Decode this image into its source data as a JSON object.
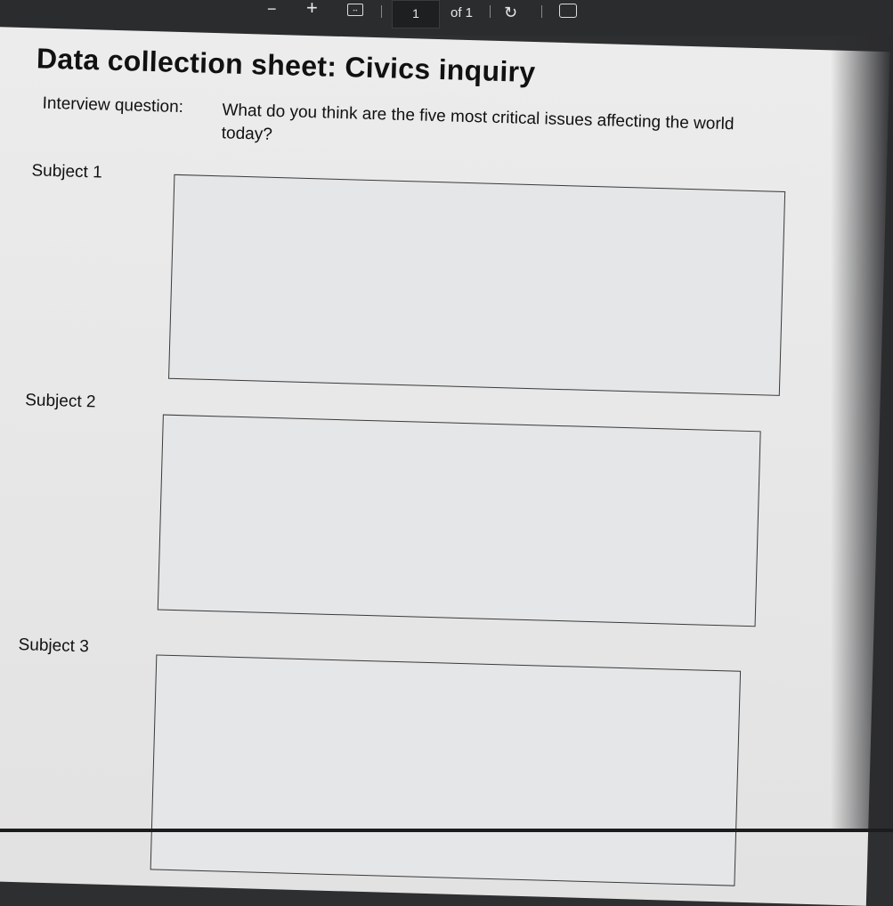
{
  "toolbar": {
    "zoom_out": "−",
    "zoom_in": "+",
    "current_page": "1",
    "page_total": "of 1"
  },
  "document": {
    "title": "Data collection sheet: Civics inquiry",
    "question_label": "Interview question:",
    "question_text": "What do you think are the five most critical issues affecting the world today?",
    "subjects": [
      {
        "label": "Subject 1",
        "answer": ""
      },
      {
        "label": "Subject 2",
        "answer": ""
      },
      {
        "label": "Subject 3",
        "answer": ""
      }
    ]
  }
}
